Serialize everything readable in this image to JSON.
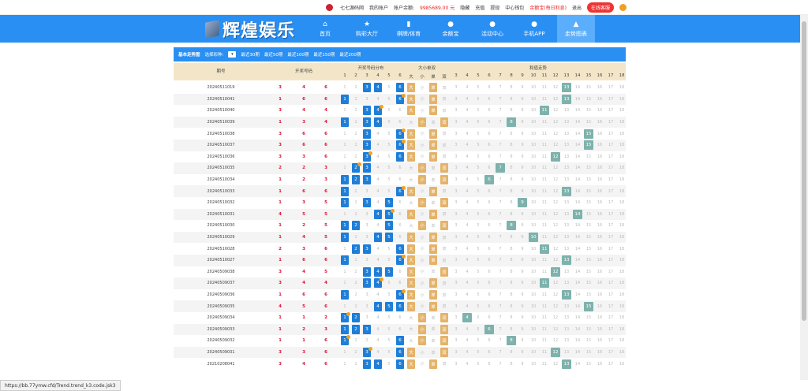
{
  "topbar": {
    "username": "七七源码网",
    "my_account": "我的账户",
    "balance_label": "账户余额:",
    "balance": "9985689.00 元",
    "hide": "隐藏",
    "recharge": "充值",
    "withdraw": "提现",
    "center": "中心钱包",
    "yuebao": "余额宝(每日利息)",
    "logout": "退出",
    "service": "在线客服"
  },
  "nav": {
    "logo": "辉煌娱乐",
    "items": [
      {
        "label": "首页",
        "icon": "home-icon"
      },
      {
        "label": "购彩大厅",
        "icon": "star-icon"
      },
      {
        "label": "棋牌/体育",
        "icon": "bookmark-icon"
      },
      {
        "label": "余额宝",
        "icon": "moneybag-icon"
      },
      {
        "label": "活动中心",
        "icon": "gift-icon"
      },
      {
        "label": "手机APP",
        "icon": "phone-icon"
      },
      {
        "label": "走势图表",
        "icon": "chart-icon"
      }
    ]
  },
  "filter": {
    "title": "基本走势图",
    "select_label": "选择彩种:",
    "options": [
      "最近30期",
      "最近50期",
      "最近100期",
      "最近150期",
      "最近200期"
    ]
  },
  "headers": {
    "period": "期号",
    "winning": "开奖号码",
    "dist": "开奖号码分布",
    "bigsmall": "大小单双",
    "big": "大",
    "small": "小",
    "odd": "单",
    "even": "双",
    "sumtrend": "和值走势",
    "dist_nums": [
      "1",
      "2",
      "3",
      "4",
      "5",
      "6"
    ],
    "sum_nums": [
      "3",
      "4",
      "5",
      "6",
      "7",
      "8",
      "9",
      "10",
      "11",
      "12",
      "13",
      "14",
      "15",
      "16",
      "17",
      "18"
    ]
  },
  "rows": [
    {
      "id": "20240511019",
      "n": [
        "3",
        "4",
        "6"
      ],
      "bs": "big",
      "oe": "odd",
      "sum": "13"
    },
    {
      "id": "20240510041",
      "n": [
        "1",
        "6",
        "6"
      ],
      "bs": "big",
      "oe": "odd",
      "sum": "13"
    },
    {
      "id": "20240510040",
      "n": [
        "3",
        "4",
        "4"
      ],
      "bs": "big",
      "oe": "odd",
      "sum": "11"
    },
    {
      "id": "20240510039",
      "n": [
        "1",
        "3",
        "4"
      ],
      "bs": "small",
      "oe": "even",
      "sum": "8"
    },
    {
      "id": "20240510038",
      "n": [
        "3",
        "6",
        "6"
      ],
      "bs": "big",
      "oe": "odd",
      "sum": "15"
    },
    {
      "id": "20240510037",
      "n": [
        "3",
        "6",
        "6"
      ],
      "bs": "big",
      "oe": "odd",
      "sum": "15"
    },
    {
      "id": "20240510036",
      "n": [
        "3",
        "3",
        "6"
      ],
      "bs": "big",
      "oe": "odd",
      "sum": "12"
    },
    {
      "id": "20240510035",
      "n": [
        "2",
        "2",
        "3"
      ],
      "bs": "small",
      "oe": "even",
      "sum": "7"
    },
    {
      "id": "20240510034",
      "n": [
        "1",
        "2",
        "3"
      ],
      "bs": "small",
      "oe": "even",
      "sum": "6"
    },
    {
      "id": "20240510033",
      "n": [
        "1",
        "6",
        "6"
      ],
      "bs": "big",
      "oe": "odd",
      "sum": "13"
    },
    {
      "id": "20240510032",
      "n": [
        "1",
        "3",
        "5"
      ],
      "bs": "small",
      "oe": "even",
      "sum": "9"
    },
    {
      "id": "20240510031",
      "n": [
        "4",
        "5",
        "5"
      ],
      "bs": "big",
      "oe": "odd",
      "sum": "14"
    },
    {
      "id": "20240510030",
      "n": [
        "1",
        "2",
        "5"
      ],
      "bs": "small",
      "oe": "even",
      "sum": "8"
    },
    {
      "id": "20240510029",
      "n": [
        "1",
        "4",
        "5"
      ],
      "bs": "big",
      "oe": "odd",
      "sum": "10"
    },
    {
      "id": "20240510028",
      "n": [
        "2",
        "3",
        "6"
      ],
      "bs": "big",
      "oe": "odd",
      "sum": "11"
    },
    {
      "id": "20240510027",
      "n": [
        "1",
        "6",
        "6"
      ],
      "bs": "big",
      "oe": "odd",
      "sum": "13"
    },
    {
      "id": "20240509038",
      "n": [
        "3",
        "4",
        "5"
      ],
      "bs": "big",
      "oe": "even",
      "sum": "12"
    },
    {
      "id": "20240509037",
      "n": [
        "3",
        "4",
        "4"
      ],
      "bs": "big",
      "oe": "odd",
      "sum": "11"
    },
    {
      "id": "20240509036",
      "n": [
        "1",
        "6",
        "6"
      ],
      "bs": "big",
      "oe": "odd",
      "sum": "13"
    },
    {
      "id": "20240509035",
      "n": [
        "4",
        "5",
        "6"
      ],
      "bs": "big",
      "oe": "odd",
      "sum": "15"
    },
    {
      "id": "20240509034",
      "n": [
        "1",
        "1",
        "2"
      ],
      "bs": "small",
      "oe": "even",
      "sum": "4"
    },
    {
      "id": "20240509033",
      "n": [
        "1",
        "2",
        "3"
      ],
      "bs": "small",
      "oe": "even",
      "sum": "6"
    },
    {
      "id": "20240509032",
      "n": [
        "1",
        "1",
        "6"
      ],
      "bs": "small",
      "oe": "even",
      "sum": "8"
    },
    {
      "id": "20240509031",
      "n": [
        "3",
        "3",
        "6"
      ],
      "bs": "big",
      "oe": "even",
      "sum": "12"
    },
    {
      "id": "20210208041",
      "n": [
        "3",
        "4",
        "6"
      ],
      "bs": "big",
      "oe": "odd",
      "sum": "13"
    }
  ],
  "status_url": "https://bb.77ymw.cfd/Trend.trend_k3.code.jsk3"
}
